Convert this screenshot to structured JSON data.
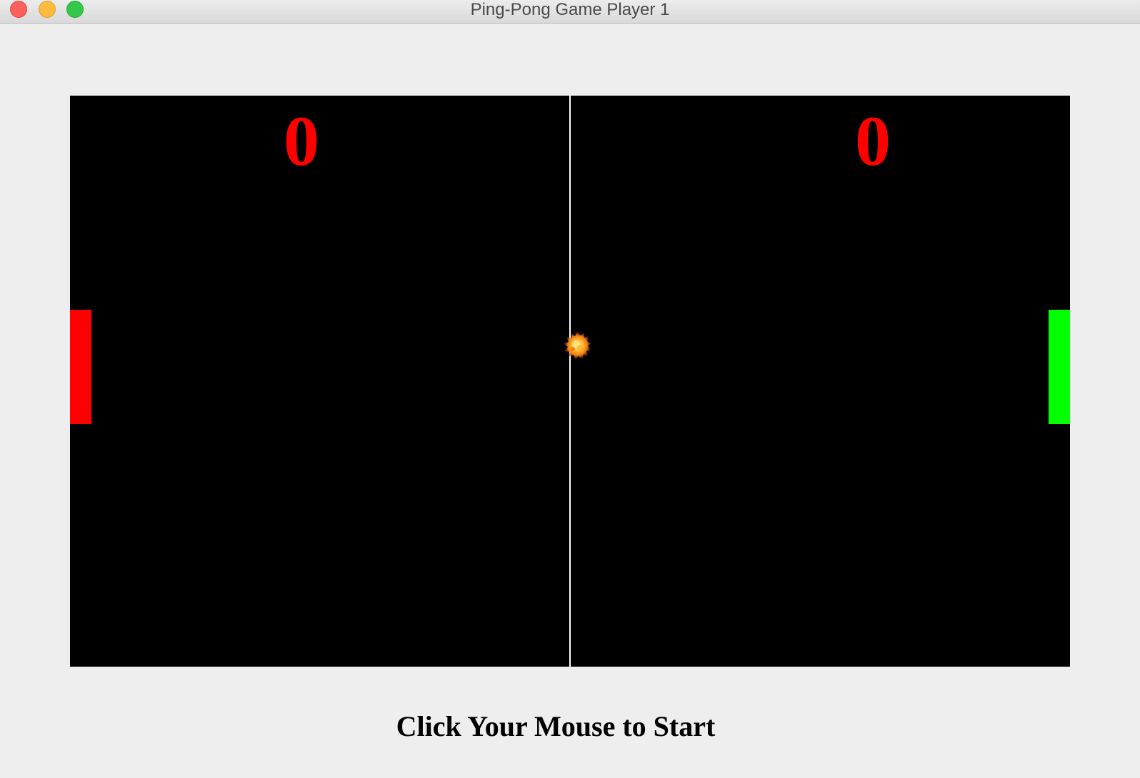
{
  "window": {
    "title": "Ping-Pong Game Player 1"
  },
  "scoreboard": {
    "left_score": "0",
    "right_score": "0",
    "score_color": "#ff0000"
  },
  "paddles": {
    "left_color": "#ff0000",
    "right_color": "#00ff00"
  },
  "ball": {
    "icon": "fireball-icon"
  },
  "board": {
    "background": "#000000",
    "net_color": "#ffffff"
  },
  "status": {
    "message": "Click Your Mouse to Start"
  }
}
